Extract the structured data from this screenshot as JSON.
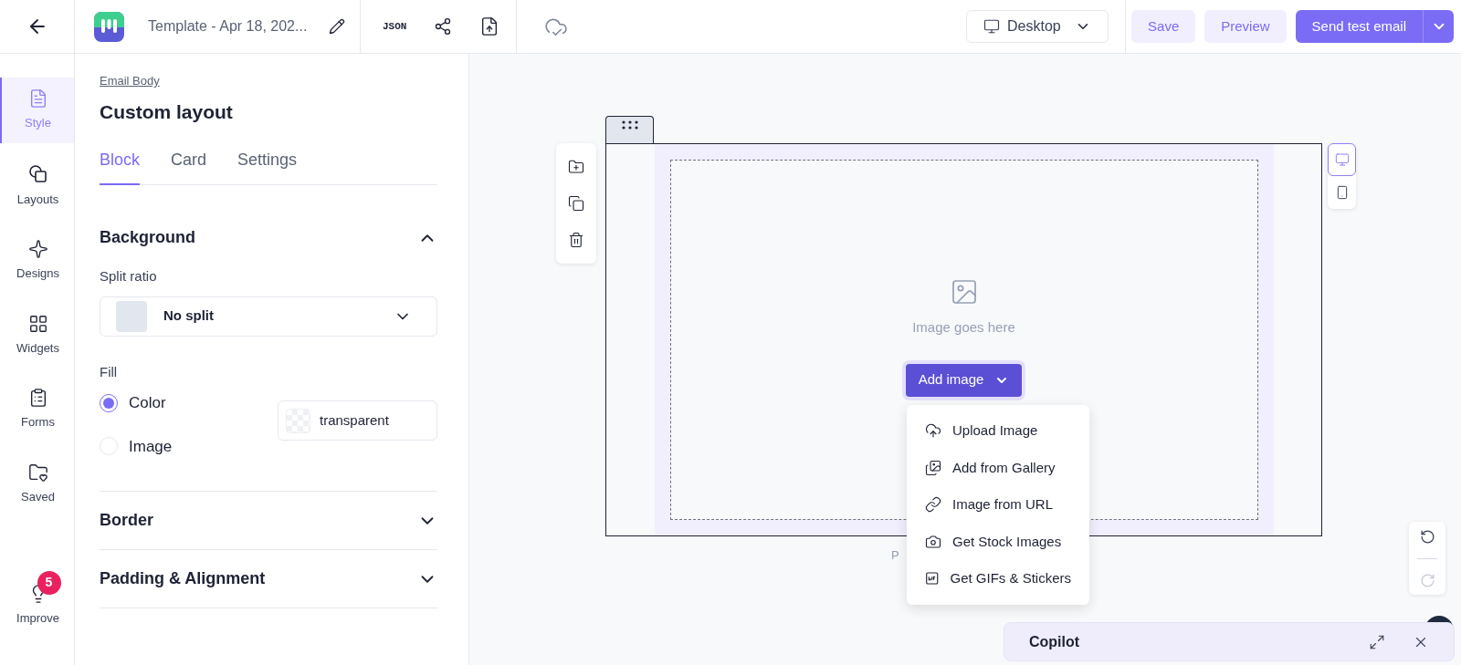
{
  "header": {
    "title": "Template - Apr 18, 202...",
    "json_label": "JSON",
    "device_select": {
      "value": "Desktop"
    },
    "buttons": [
      {
        "label": "Save",
        "kind": "soft"
      },
      {
        "label": "Preview",
        "kind": "soft"
      },
      {
        "label": "Send test email",
        "kind": "primary"
      }
    ]
  },
  "rail": [
    {
      "label": "Style",
      "selected": true
    },
    {
      "label": "Layouts",
      "selected": false
    },
    {
      "label": "Designs",
      "selected": false
    },
    {
      "label": "Widgets",
      "selected": false
    },
    {
      "label": "Forms",
      "selected": false
    },
    {
      "label": "Saved",
      "selected": false
    },
    {
      "label": "Improve",
      "selected": false,
      "badge": "5"
    }
  ],
  "panel": {
    "breadcrumb": "Email Body",
    "title": "Custom layout",
    "tabs": [
      {
        "label": "Block",
        "selected": true
      },
      {
        "label": "Card",
        "selected": false
      },
      {
        "label": "Settings",
        "selected": false
      }
    ],
    "sections": [
      {
        "title": "Background",
        "expanded": true
      },
      {
        "title": "Border",
        "expanded": false
      },
      {
        "title": "Padding & Alignment",
        "expanded": false
      }
    ],
    "split_ratio": {
      "label": "Split ratio",
      "value": "No split"
    },
    "fill": {
      "label": "Fill",
      "options": [
        {
          "label": "Color",
          "selected": true
        },
        {
          "label": "Image",
          "selected": false
        }
      ],
      "color_value": "transparent"
    }
  },
  "canvas": {
    "placeholder_text": "Image goes here",
    "add_button": "Add image",
    "menu": [
      "Upload Image",
      "Add from Gallery",
      "Image from URL",
      "Get Stock Images",
      "Get GIFs & Stickers"
    ],
    "footer_text": "P",
    "device_toggle": [
      {
        "selected": true
      },
      {
        "selected": false
      }
    ],
    "history": [
      {
        "disabled": false
      },
      {
        "disabled": true
      }
    ]
  },
  "copilot": {
    "title": "Copilot"
  }
}
